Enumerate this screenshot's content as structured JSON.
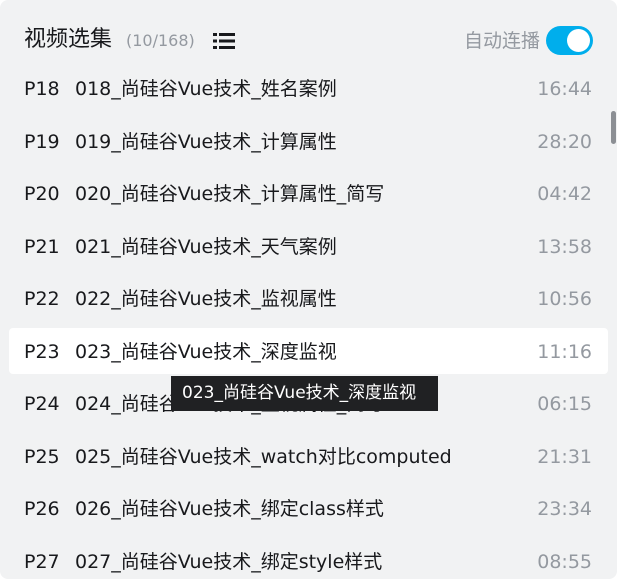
{
  "header": {
    "title": "视频选集",
    "count": "(10/168)",
    "list_icon": "list-view-icon",
    "autoplay_label": "自动连播",
    "autoplay_on": true
  },
  "colors": {
    "accent": "#00aeec",
    "text": "#18191c",
    "muted": "#9499a0",
    "panel_bg": "#f1f2f3",
    "tooltip_bg": "#202123"
  },
  "episodes": [
    {
      "index": "P18",
      "title": "018_尚硅谷Vue技术_姓名案例",
      "duration": "16:44"
    },
    {
      "index": "P19",
      "title": "019_尚硅谷Vue技术_计算属性",
      "duration": "28:20"
    },
    {
      "index": "P20",
      "title": "020_尚硅谷Vue技术_计算属性_简写",
      "duration": "04:42"
    },
    {
      "index": "P21",
      "title": "021_尚硅谷Vue技术_天气案例",
      "duration": "13:58"
    },
    {
      "index": "P22",
      "title": "022_尚硅谷Vue技术_监视属性",
      "duration": "10:56"
    },
    {
      "index": "P23",
      "title": "023_尚硅谷Vue技术_深度监视",
      "duration": "11:16",
      "active": true
    },
    {
      "index": "P24",
      "title": "024_尚硅谷Vue技术_监视属性_简写",
      "duration": "06:15"
    },
    {
      "index": "P25",
      "title": "025_尚硅谷Vue技术_watch对比computed",
      "duration": "21:31"
    },
    {
      "index": "P26",
      "title": "026_尚硅谷Vue技术_绑定class样式",
      "duration": "23:34"
    },
    {
      "index": "P27",
      "title": "027_尚硅谷Vue技术_绑定style样式",
      "duration": "08:55"
    }
  ],
  "tooltip": {
    "text": "023_尚硅谷Vue技术_深度监视"
  }
}
